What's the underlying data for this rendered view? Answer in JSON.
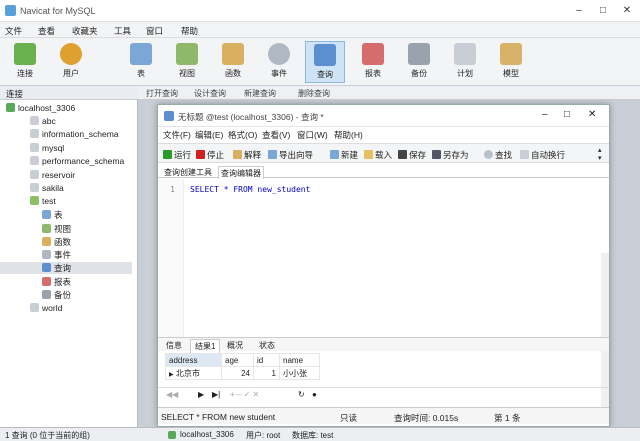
{
  "app": {
    "title": "Navicat for MySQL",
    "icon": "navicat-logo-icon"
  },
  "menu": [
    "文件",
    "查看",
    "收藏夹",
    "工具",
    "窗口",
    "帮助"
  ],
  "toolbar": [
    {
      "label": "连接",
      "icon": "connection-icon"
    },
    {
      "label": "用户",
      "icon": "user-icon"
    },
    {
      "label": "表",
      "icon": "table-icon"
    },
    {
      "label": "视图",
      "icon": "view-icon"
    },
    {
      "label": "函数",
      "icon": "function-icon"
    },
    {
      "label": "事件",
      "icon": "event-icon"
    },
    {
      "label": "查询",
      "icon": "query-icon",
      "active": true
    },
    {
      "label": "报表",
      "icon": "report-icon"
    },
    {
      "label": "备份",
      "icon": "backup-icon"
    },
    {
      "label": "计划",
      "icon": "schedule-icon"
    },
    {
      "label": "模型",
      "icon": "model-icon"
    }
  ],
  "left_panel": {
    "header": "连接",
    "tree": [
      {
        "label": "localhost_3306",
        "indent": 0,
        "icon": "server-icon"
      },
      {
        "label": "abc",
        "indent": 1,
        "icon": "database-icon"
      },
      {
        "label": "information_schema",
        "indent": 1,
        "icon": "database-icon"
      },
      {
        "label": "mysql",
        "indent": 1,
        "icon": "database-icon"
      },
      {
        "label": "performance_schema",
        "indent": 1,
        "icon": "database-icon"
      },
      {
        "label": "reservoir",
        "indent": 1,
        "icon": "database-icon"
      },
      {
        "label": "sakila",
        "indent": 1,
        "icon": "database-icon"
      },
      {
        "label": "test",
        "indent": 1,
        "icon": "database-open-icon"
      },
      {
        "label": "表",
        "indent": 2,
        "icon": "table-icon"
      },
      {
        "label": "视图",
        "indent": 2,
        "icon": "view-icon"
      },
      {
        "label": "函数",
        "indent": 2,
        "icon": "function-icon"
      },
      {
        "label": "事件",
        "indent": 2,
        "icon": "event-icon"
      },
      {
        "label": "查询",
        "indent": 2,
        "icon": "query-icon",
        "selected": true
      },
      {
        "label": "报表",
        "indent": 2,
        "icon": "report-icon"
      },
      {
        "label": "备份",
        "indent": 2,
        "icon": "backup-icon"
      },
      {
        "label": "world",
        "indent": 1,
        "icon": "database-icon"
      }
    ]
  },
  "object_toolbar": [
    "打开查询",
    "设计查询",
    "新建查询",
    "删除查询"
  ],
  "query_window": {
    "title": "无标题 @test (localhost_3306) - 查询 *",
    "menu": [
      "文件(F)",
      "编辑(E)",
      "格式(O)",
      "查看(V)",
      "窗口(W)",
      "帮助(H)"
    ],
    "tools": [
      "运行",
      "停止",
      "解释",
      "导出向导",
      "新建",
      "载入",
      "保存",
      "另存为",
      "查找",
      "自动换行"
    ],
    "tabs": [
      "查询创建工具",
      "查询编辑器"
    ],
    "line_no": "1",
    "sql": "SELECT * FROM new_student",
    "result_tabs": [
      "信息",
      "结果1",
      "概况",
      "状态"
    ],
    "columns": [
      "address",
      "age",
      "id",
      "name"
    ],
    "rows": [
      [
        "北京市",
        "24",
        "1",
        "小小张"
      ]
    ],
    "status": {
      "sql": "SELECT * FROM new student",
      "mode": "只读",
      "time": "查询时间: 0.015s",
      "record": "第 1 条"
    }
  },
  "statusbar": {
    "left": "1 查询 (0 位于当前的组)",
    "conn": "localhost_3306",
    "user": "用户: root",
    "db": "数据库: test"
  },
  "colors": {
    "accent": "#cfe3f7",
    "window_bg": "#c9cfd6",
    "run": "#2a9a2a",
    "stop": "#d02020",
    "keyword": "#0000cc"
  }
}
